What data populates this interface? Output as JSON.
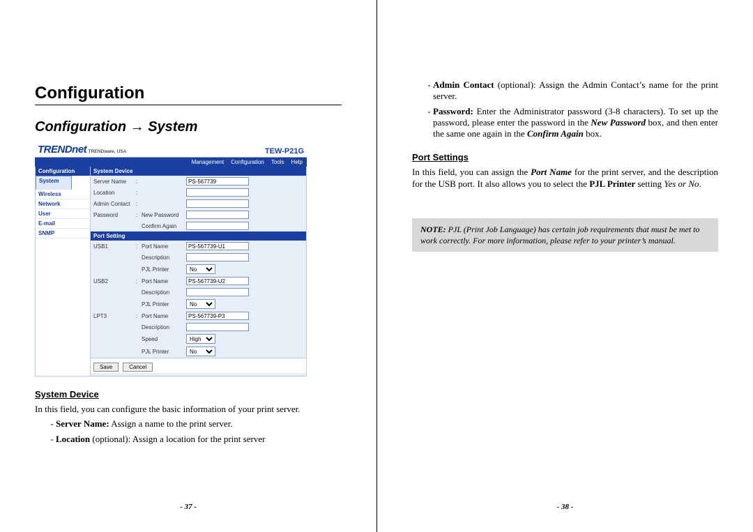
{
  "left": {
    "title": "Configuration",
    "subtitle": "Configuration → System",
    "brand": "TRENDnet",
    "brand_sub": "TRENDware, USA",
    "model": "TEW-P21G",
    "menubar": [
      "Management",
      "Configuration",
      "Tools",
      "Help"
    ],
    "sidebar_header": "Configuration",
    "sidebar_items": [
      "System",
      "Wireless",
      "Network",
      "User",
      "E-mail",
      "SNMP"
    ],
    "grp1": "System Device",
    "server_name_label": "Server Name",
    "server_name_value": "PS-567739",
    "location_label": "Location",
    "admin_contact_label": "Admin Contact",
    "password_label": "Password",
    "new_password_label": "New Password",
    "confirm_again_label": "Confirm Again",
    "grp2": "Port Setting",
    "port1": "USB1",
    "port2": "USB2",
    "port3": "LPT3",
    "port_name_label": "Port Name",
    "description_label": "Description",
    "pjl_label": "PJL Printer",
    "speed_label": "Speed",
    "port1_name": "PS-567739-U1",
    "port2_name": "PS-567739-U2",
    "port3_name": "PS-567739-P3",
    "pjl_value": "No",
    "speed_value": "High",
    "btn_save": "Save",
    "btn_cancel": "Cancel",
    "h_system_device": "System Device",
    "p_system_device": "In this field, you can configure the basic information of your print server.",
    "li_server_name_b": "Server Name:",
    "li_server_name": " Assign a name to the print server.",
    "li_location_b": "Location",
    "li_location_opt": " (optional):",
    "li_location": " Assign a location for the print server",
    "page_num": "- 37 -"
  },
  "right": {
    "li_admin_b": "Admin Contact",
    "li_admin_opt": " (optional):",
    "li_admin": " Assign the Admin Contact’s name for the print server.",
    "li_pass_b": "Password:",
    "li_pass_1": " Enter the Administrator password (3-8 characters). To set up the password, please enter the password in the ",
    "li_pass_new": "New Password",
    "li_pass_2": " box, and then enter the same one again in the ",
    "li_pass_conf": "Confirm Again",
    "li_pass_3": " box.",
    "h_port": "Port Settings",
    "p_port_1": "In this field, you can assign the ",
    "p_port_b1": "Port Name",
    "p_port_2": " for the print server, and the description for the USB port.   It also allows you to select the ",
    "p_port_b2": "PJL Printer",
    "p_port_3": " setting ",
    "p_port_i": "Yes or No",
    "p_port_4": ".",
    "note_b": "NOTE:",
    "note": " PJL (Print Job Language) has certain job requirements that must be met to work correctly.   For more information, please refer to your printer’s manual.",
    "page_num": "- 38 -"
  }
}
